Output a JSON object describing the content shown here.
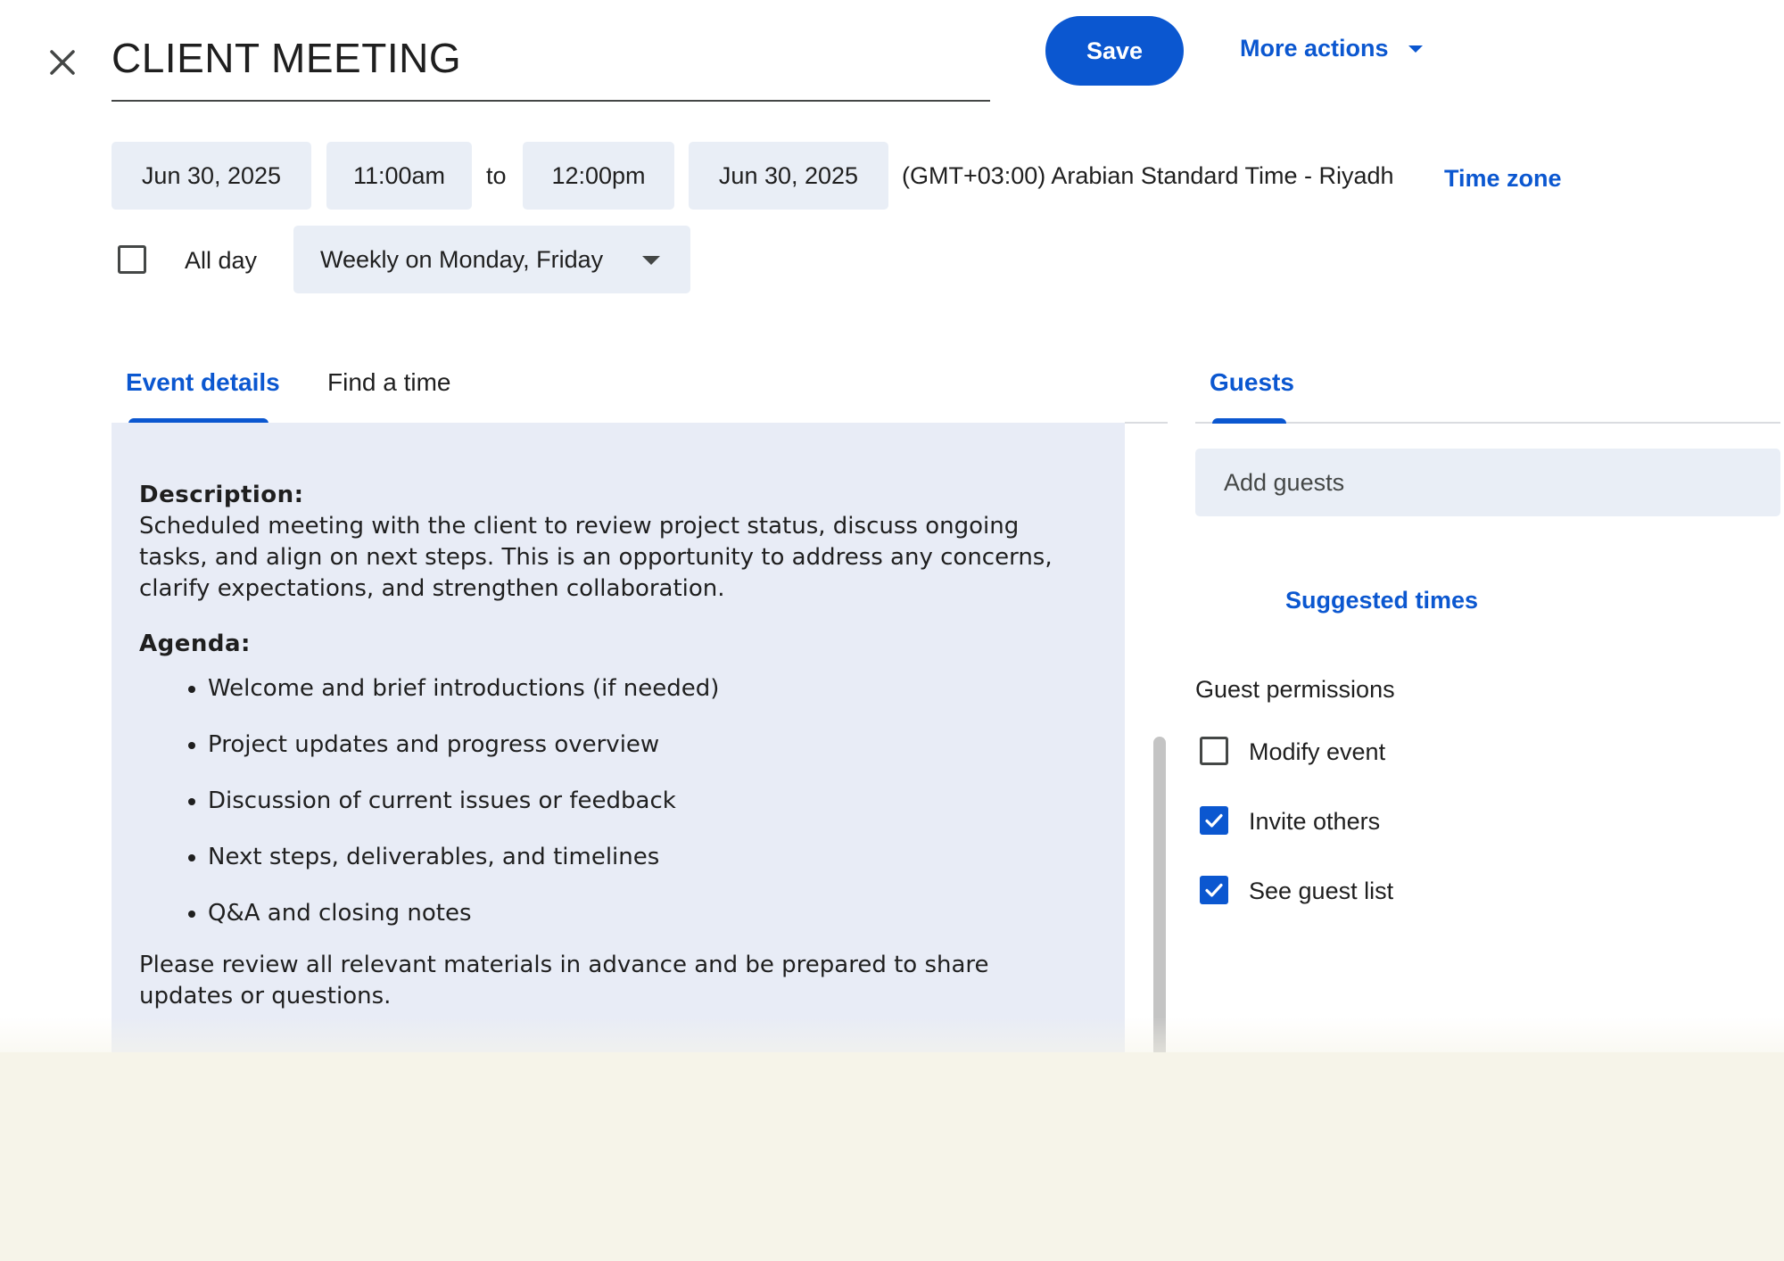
{
  "header": {
    "title": "CLIENT MEETING",
    "save_label": "Save",
    "more_actions_label": "More actions"
  },
  "datetime": {
    "start_date": "Jun 30, 2025",
    "start_time": "11:00am",
    "to_label": "to",
    "end_time": "12:00pm",
    "end_date": "Jun 30, 2025",
    "timezone": "(GMT+03:00) Arabian Standard Time - Riyadh",
    "timezone_link": "Time zone",
    "all_day_label": "All day",
    "all_day_checked": false,
    "recurrence": "Weekly on Monday, Friday"
  },
  "tabs": [
    {
      "label": "Event details",
      "active": true
    },
    {
      "label": "Find a time",
      "active": false
    }
  ],
  "description": {
    "description_label": "Description:",
    "description_text": "Scheduled meeting with the client to review project status, discuss ongoing tasks, and align on next steps. This is an opportunity to address any concerns, clarify expectations, and strengthen collaboration.",
    "agenda_label": "Agenda:",
    "agenda_items": [
      "Welcome and brief introductions (if needed)",
      "Project updates and progress overview",
      "Discussion of current issues or feedback",
      "Next steps, deliverables, and timelines",
      "Q&A and closing notes"
    ],
    "closing_text": "Please review all relevant materials in advance and be prepared to share updates or questions."
  },
  "guests": {
    "tab_label": "Guests",
    "add_guests_placeholder": "Add guests",
    "suggested_times": "Suggested times",
    "permissions_label": "Guest permissions",
    "permissions": [
      {
        "label": "Modify event",
        "checked": false
      },
      {
        "label": "Invite others",
        "checked": true
      },
      {
        "label": "See guest list",
        "checked": true
      }
    ]
  },
  "colors": {
    "accent": "#0b57d0",
    "chip_bg": "#e9eef6",
    "panel_bg": "#e8ecf6",
    "footer_bg": "#f6f4e9"
  }
}
